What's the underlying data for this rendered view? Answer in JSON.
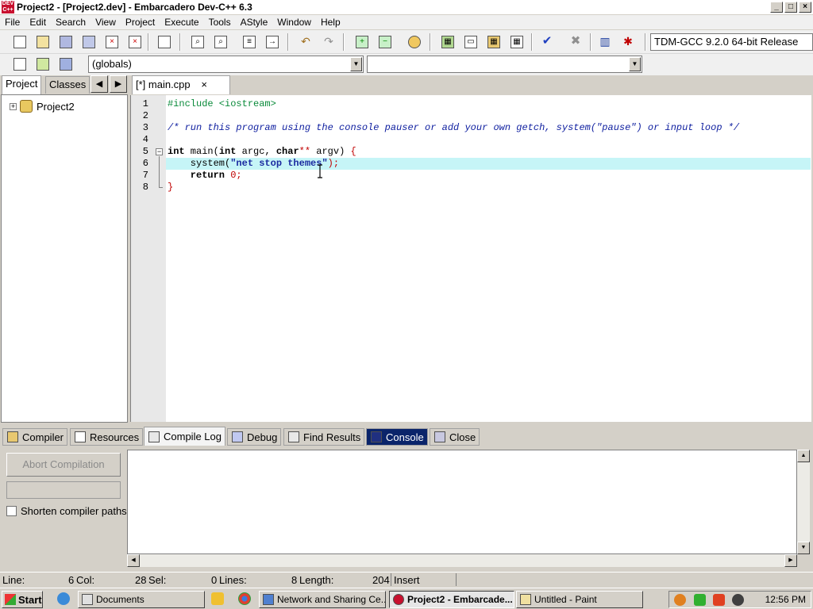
{
  "window": {
    "title": "Project2 - [Project2.dev] - Embarcadero Dev-C++ 6.3",
    "app_icon_text": "DEV C++"
  },
  "menu": [
    "File",
    "Edit",
    "Search",
    "View",
    "Project",
    "Execute",
    "Tools",
    "AStyle",
    "Window",
    "Help"
  ],
  "toolbar": {
    "compiler": "TDM-GCC 9.2.0 64-bit Release",
    "scope": "(globals)",
    "function": ""
  },
  "left_panel": {
    "tabs": [
      "Project",
      "Classes"
    ],
    "tree_root": "Project2"
  },
  "editor": {
    "tab_label": "[*] main.cpp",
    "current_line": 6,
    "line_numbers": [
      "1",
      "2",
      "3",
      "4",
      "5",
      "6",
      "7",
      "8"
    ],
    "code": {
      "l1": "#include <iostream>",
      "l3": "/* run this program using the console pauser or add your own getch, system(\"pause\") or input loop */",
      "l5_kw1": "int",
      "l5_mid1": " main(",
      "l5_kw2": "int",
      "l5_mid2": " argc, ",
      "l5_kw3": "char",
      "l5_sym": "**",
      "l5_mid3": " argv) ",
      "l5_brace": "{",
      "l6_pre": "    system(",
      "l6_str": "\"net stop themes\"",
      "l6_post": ");",
      "l7_kw": "    return",
      "l7_num": "0",
      "l7_post": ";",
      "l8": "}"
    }
  },
  "bottom_panel": {
    "tabs": [
      "Compiler",
      "Resources",
      "Compile Log",
      "Debug",
      "Find Results",
      "Console",
      "Close"
    ],
    "active_tab": "Compile Log",
    "abort_button": "Abort Compilation",
    "shorten_label": "Shorten compiler paths"
  },
  "status": {
    "line_label": "Line:",
    "line_value": "6",
    "col_label": "Col:",
    "col_value": "28",
    "sel_label": "Sel:",
    "sel_value": "0",
    "lines_label": "Lines:",
    "lines_value": "8",
    "length_label": "Length:",
    "length_value": "204",
    "mode": "Insert"
  },
  "taskbar": {
    "start": "Start",
    "buttons": [
      "Documents",
      "Network and Sharing Ce...",
      "Project2 - Embarcade...",
      "Untitled - Paint"
    ],
    "clock": "12:56 PM"
  }
}
